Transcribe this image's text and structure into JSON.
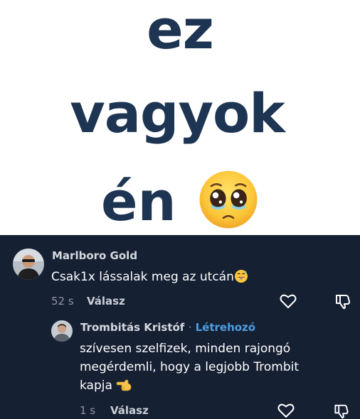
{
  "hero": {
    "line1": "ez",
    "line2": "vagyok",
    "line3": "én",
    "emoji": "pleading-face"
  },
  "comments": [
    {
      "author": "Marlboro Gold",
      "text": "Csak1x lássalak meg az utcán",
      "emoji": "grinning-sweat-face",
      "time": "52 s",
      "reply_label": "Válasz"
    },
    {
      "author": "Trombitás Kristóf",
      "separator": "·",
      "badge": "Létrehozó",
      "text_lines": [
        "szívesen szelfizek, minden rajongó",
        "megérdemli, hogy a legjobb Trombit",
        "kapja"
      ],
      "emoji": "pointing-hand",
      "time": "1 s",
      "reply_label": "Válasz"
    }
  ],
  "colors": {
    "hero_text": "#1d3452",
    "panel_bg": "#162033",
    "creator_badge": "#4d9de0"
  }
}
